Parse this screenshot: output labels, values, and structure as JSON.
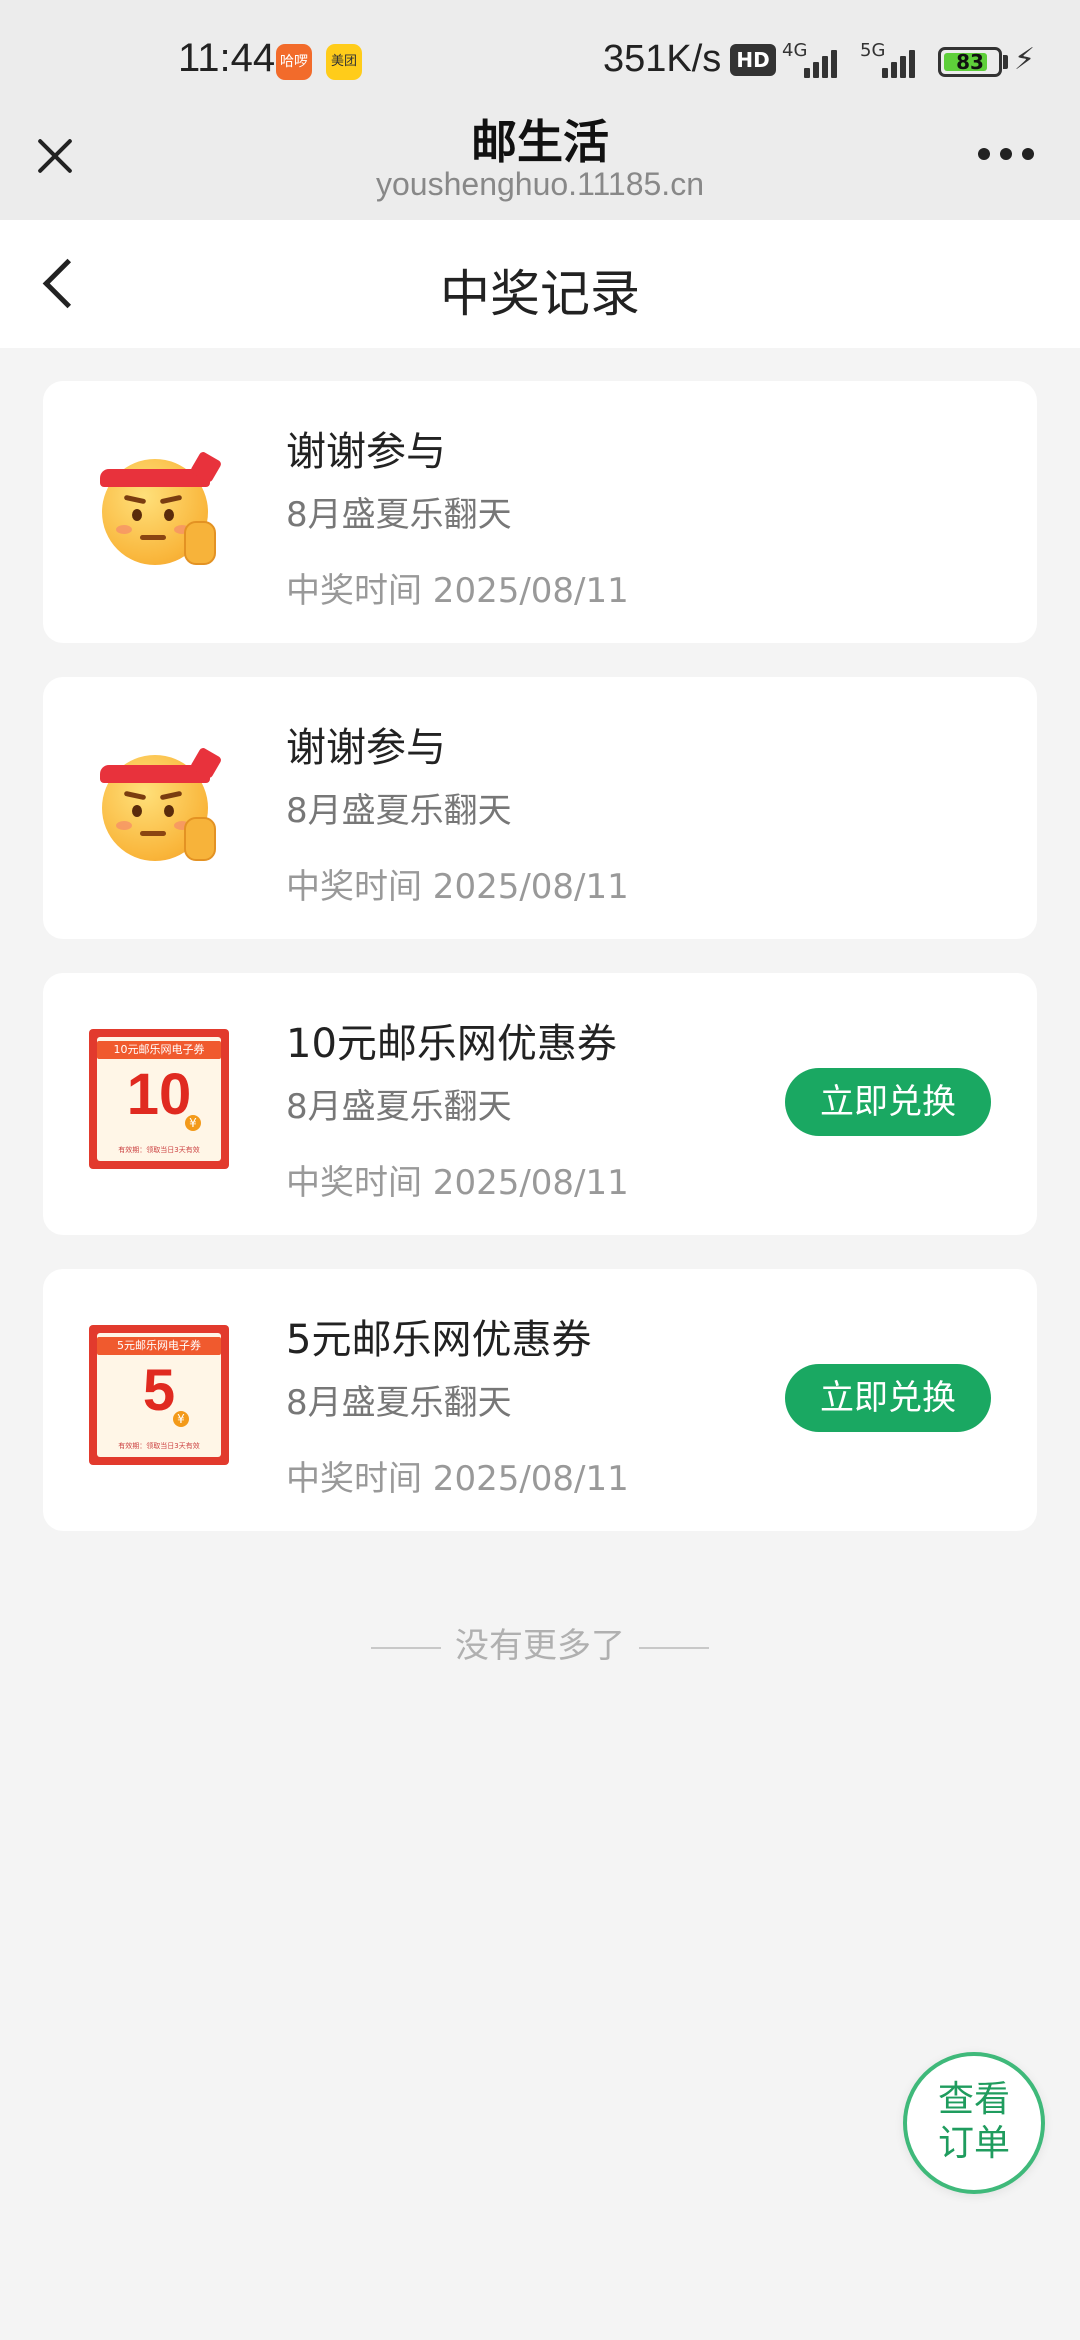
{
  "status_bar": {
    "time": "11:44",
    "app1": "哈啰",
    "app2": "美团",
    "speed": "351K/s",
    "hd": "HD",
    "net1": "4G",
    "net2": "5G",
    "battery": "83",
    "battery_level": 0.83
  },
  "topbar": {
    "title": "邮生活",
    "url": "youshenghuo.11185.cn"
  },
  "page": {
    "title": "中奖记录"
  },
  "records": [
    {
      "kind": "emoji",
      "title": "谢谢参与",
      "activity": "8月盛夏乐翻天",
      "time": "中奖时间 2025/08/11",
      "action": ""
    },
    {
      "kind": "emoji",
      "title": "谢谢参与",
      "activity": "8月盛夏乐翻天",
      "time": "中奖时间 2025/08/11",
      "action": ""
    },
    {
      "kind": "coupon",
      "coupon_head": "10元邮乐网电子券",
      "coupon_amount": "10",
      "coupon_foot": "有效期：领取当日3天有效",
      "title": "10元邮乐网优惠券",
      "activity": "8月盛夏乐翻天",
      "time": "中奖时间 2025/08/11",
      "action": "立即兑换"
    },
    {
      "kind": "coupon",
      "coupon_head": "5元邮乐网电子券",
      "coupon_amount": "5",
      "coupon_foot": "有效期：领取当日3天有效",
      "title": "5元邮乐网优惠券",
      "activity": "8月盛夏乐翻天",
      "time": "中奖时间 2025/08/11",
      "action": "立即兑换"
    }
  ],
  "footer": {
    "no_more": "没有更多了"
  },
  "fab": {
    "line1": "查看",
    "line2": "订单"
  },
  "colors": {
    "accent": "#1aa862",
    "background": "#f4f4f4"
  }
}
